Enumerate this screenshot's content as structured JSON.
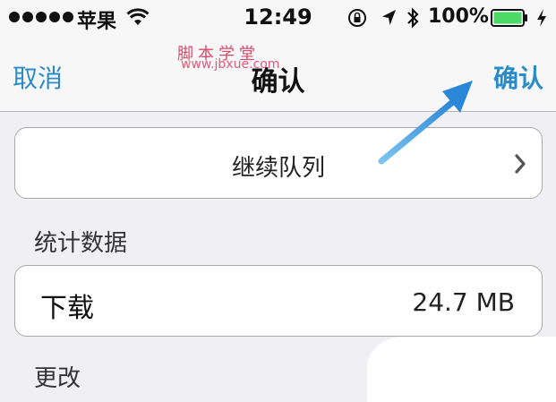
{
  "status_bar": {
    "carrier": "苹果",
    "time": "12:49",
    "battery_percent": "100%",
    "icons": [
      "signal-dots-icon",
      "wifi-icon",
      "orientation-lock-icon",
      "location-arrow-icon",
      "bluetooth-icon",
      "battery-icon",
      "charging-bolt-icon"
    ]
  },
  "nav": {
    "left_label": "取消",
    "title": "确认",
    "right_label": "确认"
  },
  "watermark": {
    "cn": "脚本学堂",
    "url": "www.jbxue.com"
  },
  "queue_row": {
    "label": "继续队列"
  },
  "stats": {
    "header": "统计数据",
    "download_label": "下载",
    "download_value": "24.7 MB"
  },
  "change": {
    "header": "更改"
  },
  "colors": {
    "accent": "#2a8bc8",
    "background": "#efeff4",
    "battery": "#4cd964",
    "arrow": "#3a9de0"
  }
}
